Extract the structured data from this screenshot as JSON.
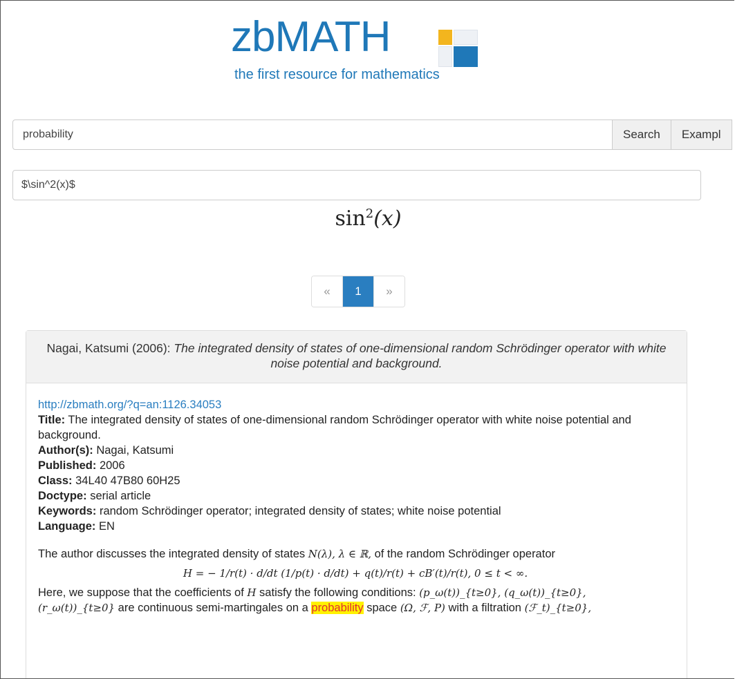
{
  "logo": {
    "word": "zbMATH",
    "tagline": "the first resource for mathematics",
    "colors": {
      "blue": "#1f78b8",
      "yellow": "#f3b51e"
    }
  },
  "search": {
    "value": "probability",
    "search_label": "Search",
    "examples_label": "Exampl"
  },
  "formula": {
    "value": "$\\sin^2(x)$",
    "rendered_base": "sin",
    "rendered_exp": "2",
    "rendered_arg": "(x)"
  },
  "pagination": {
    "prev": "«",
    "current": "1",
    "next": "»"
  },
  "result": {
    "header_author": "Nagai, Katsumi (2006):",
    "header_title": "The integrated density of states of one-dimensional random Schrödinger operator with white noise potential and background.",
    "link": "http://zbmath.org/?q=an:1126.34053",
    "title_label": "Title:",
    "title_value": "The integrated density of states of one-dimensional random Schrödinger operator with white noise potential and background.",
    "authors_label": "Author(s):",
    "authors_value": "Nagai, Katsumi",
    "published_label": "Published:",
    "published_value": "2006",
    "class_label": "Class:",
    "class_value": "34L40 47B80 60H25",
    "doctype_label": "Doctype:",
    "doctype_value": "serial article",
    "keywords_label": "Keywords:",
    "keywords_value": "random Schrödinger operator; integrated density of states; white noise potential",
    "language_label": "Language:",
    "language_value": "EN",
    "review_p1a": "The author discusses the integrated density of states ",
    "review_p1b": "N(λ), λ ∈ ℝ,",
    "review_p1c": " of the random Schrödinger operator",
    "display_formula": "H = − 1/r(t) · d/dt (1/p(t) · d/dt) + q(t)/r(t) + cB′(t)/r(t), 0 ≤ t < ∞.",
    "review_p2a": "Here, we suppose that the coefficients of ",
    "review_p2b": "H",
    "review_p2c": " satisfy the following conditions: ",
    "review_p2d": "(p_ω(t))_{t≥0}, (q_ω(t))_{t≥0},",
    "review_p3a": "(r_ω(t))_{t≥0}",
    "review_p3b": " are continuous semi-martingales on a ",
    "review_p3hl": "probability",
    "review_p3c": " space ",
    "review_p3d": "(Ω, ℱ, P)",
    "review_p3e": " with a filtration ",
    "review_p3f": "(ℱ_t)_{t≥0},"
  }
}
